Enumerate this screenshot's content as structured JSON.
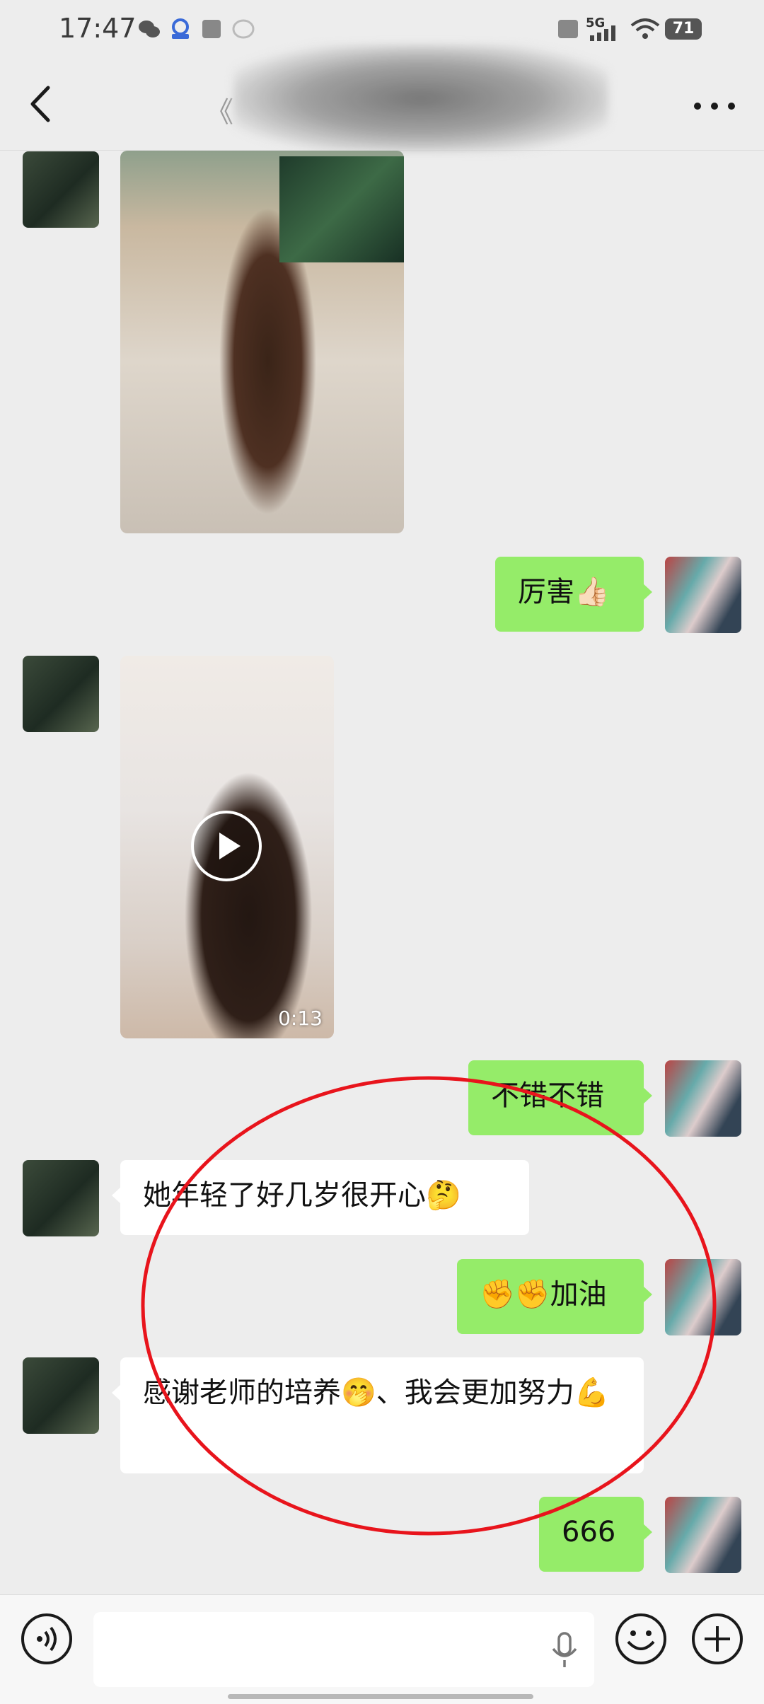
{
  "status_bar": {
    "time": "17:47",
    "network": "5G",
    "battery": "71"
  },
  "header": {
    "title": "《"
  },
  "messages": [
    {
      "direction": "in",
      "type": "image"
    },
    {
      "direction": "out",
      "type": "text",
      "text": "厉害👍🏻"
    },
    {
      "direction": "in",
      "type": "video",
      "duration": "0:13"
    },
    {
      "direction": "out",
      "type": "text",
      "text": "不错不错"
    },
    {
      "direction": "in",
      "type": "text",
      "text": "她年轻了好几岁很开心🤔"
    },
    {
      "direction": "out",
      "type": "text",
      "text": "✊✊加油"
    },
    {
      "direction": "in",
      "type": "text",
      "text": "感谢老师的培养🤭、我会更加努力💪"
    },
    {
      "direction": "out",
      "type": "text",
      "text": "666"
    }
  ],
  "colors": {
    "background": "#ededed",
    "bubble_out": "#95ec69",
    "bubble_in": "#ffffff",
    "annotation": "#e8141c"
  }
}
